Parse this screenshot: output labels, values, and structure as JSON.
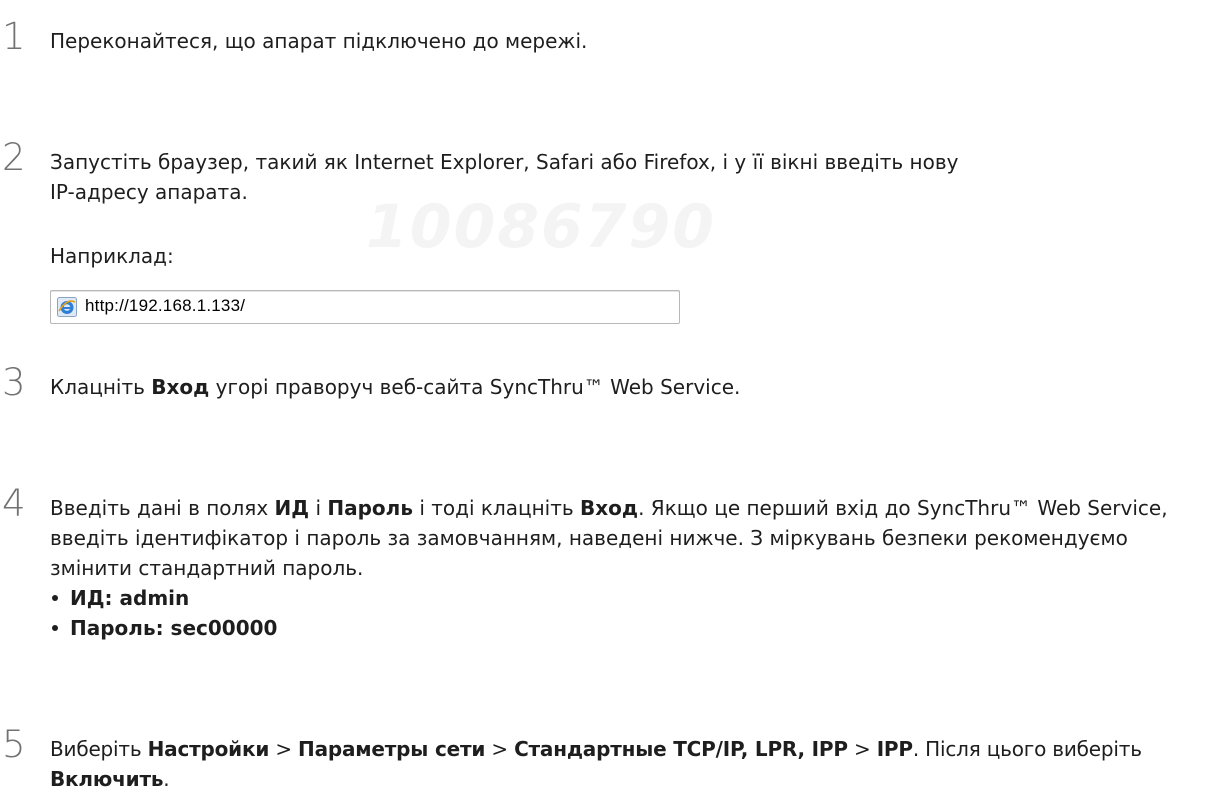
{
  "watermark": "10086790",
  "step1": {
    "num": "1",
    "text": "Переконайтеся, що апарат підключено до мережі."
  },
  "step2": {
    "num": "2",
    "line1": "Запустіть браузер, такий як Internet Explorer, Safari або Firefox, і у її вікні введіть нову",
    "line2": "IP-адресу апарата.",
    "example_label": "Наприклад:",
    "url": "http://192.168.1.133/",
    "browser_icon": "internet-explorer-icon"
  },
  "step3": {
    "num": "3",
    "t1": "Клацніть ",
    "b1": "Вход",
    "t2": " угорі праворуч веб-сайта SyncThru™ Web Service."
  },
  "step4": {
    "num": "4",
    "t1": "Введіть дані в полях ",
    "b1": "ИД",
    "t2": " і ",
    "b2": "Пароль",
    "t3": " і тоді клацніть ",
    "b3": "Вход",
    "t4": ". Якщо це перший вхід до SyncThru™ Web Service, введіть ідентифікатор і пароль за замовчанням, наведені нижче. З міркувань безпеки рекомендуємо змінити стандартний пароль.",
    "bullets": [
      "ИД: admin",
      "Пароль: sec00000"
    ]
  },
  "step5": {
    "num": "5",
    "t1": "Виберіть ",
    "b1": "Настройки",
    "sep1": " > ",
    "b2": "Параметры сети",
    "sep2": " > ",
    "b3": "Стандартные TCP/IP, LPR, IPP",
    "sep3": " > ",
    "b4": "IPP",
    "t2": ". Після цього виберіть ",
    "b5": "Включить",
    "t3": "."
  }
}
